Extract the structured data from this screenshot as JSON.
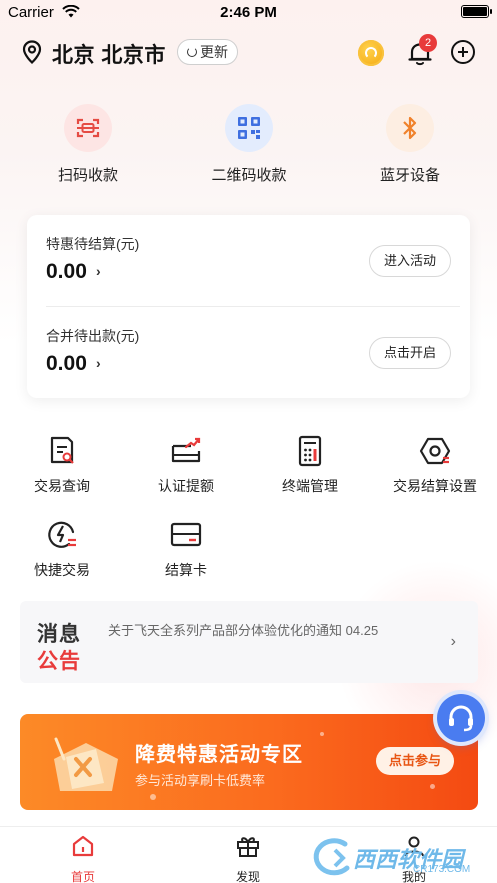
{
  "status_bar": {
    "carrier": "Carrier",
    "time": "2:46 PM"
  },
  "header": {
    "location": "北京 北京市",
    "update_label": "更新",
    "notification_count": "2"
  },
  "quick_actions": [
    {
      "label": "扫码收款",
      "icon": "scan-icon"
    },
    {
      "label": "二维码收款",
      "icon": "qrcode-icon"
    },
    {
      "label": "蓝牙设备",
      "icon": "bluetooth-icon"
    }
  ],
  "settlement_card": {
    "rows": [
      {
        "title": "特惠待结算(元)",
        "amount": "0.00",
        "button": "进入活动"
      },
      {
        "title": "合并待出款(元)",
        "amount": "0.00",
        "button": "点击开启"
      }
    ]
  },
  "services": [
    {
      "label": "交易查询",
      "icon": "transaction-query-icon"
    },
    {
      "label": "认证提额",
      "icon": "limit-raise-icon"
    },
    {
      "label": "终端管理",
      "icon": "terminal-icon"
    },
    {
      "label": "交易结算设置",
      "icon": "settlement-settings-icon"
    },
    {
      "label": "快捷交易",
      "icon": "quick-trade-icon"
    },
    {
      "label": "结算卡",
      "icon": "bank-card-icon"
    }
  ],
  "notice": {
    "tag_line1": "消息",
    "tag_line2": "公告",
    "message": "关于飞天全系列产品部分体验优化的通知",
    "date": "04.25"
  },
  "banner": {
    "title": "降费特惠活动专区",
    "subtitle": "参与活动享刷卡低费率",
    "button": "点击参与"
  },
  "tab_bar": [
    {
      "label": "首页",
      "active": true
    },
    {
      "label": "发现",
      "active": false
    },
    {
      "label": "我的",
      "active": false
    }
  ],
  "watermark": {
    "text": "西西软件园",
    "domain": "CR173.COM"
  },
  "colors": {
    "accent": "#e83b3b",
    "banner_orange": "#fb6b1e",
    "service_blue": "#4a7cf0"
  }
}
